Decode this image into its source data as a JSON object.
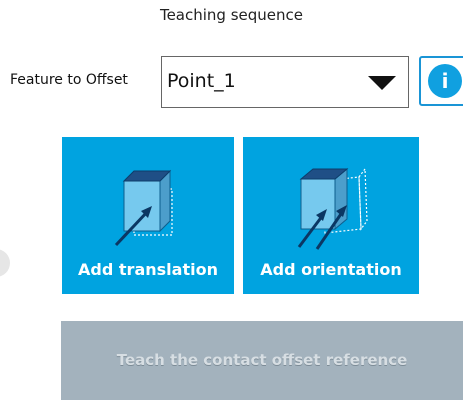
{
  "header": {
    "title": "Teaching sequence"
  },
  "feature": {
    "label": "Feature to Offset",
    "selected_value": "Point_1"
  },
  "info_button": {
    "glyph": "i"
  },
  "actions": {
    "add_translation_label": "Add translation",
    "add_orientation_label": "Add orientation",
    "teach_button_label": "Teach the contact offset reference"
  },
  "colors": {
    "accent": "#00a3e0",
    "disabled_button": "#a3b2bd"
  },
  "icons": {
    "translation": "cube-translation-arrow-icon",
    "orientation": "cube-orientation-arrows-icon",
    "info": "info-icon",
    "dropdown": "caret-down-icon"
  }
}
